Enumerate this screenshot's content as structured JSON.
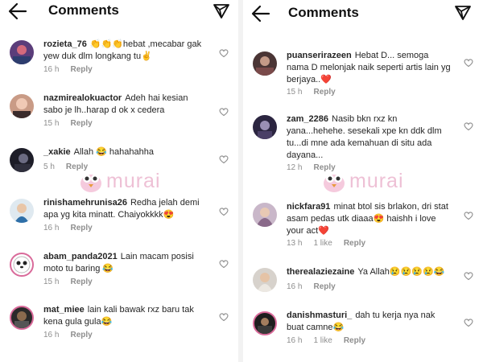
{
  "left": {
    "title": "Comments",
    "comments": [
      {
        "user": "rozieta_76",
        "text": "👏👏👏hebat ,mecabar gak yew duk dlm longkang tu✌️",
        "time": "16 h",
        "reply": "Reply"
      },
      {
        "user": "nazmirealokuactor",
        "text": "Adeh hai kesian sabo je lh..harap d ok x cedera",
        "time": "15 h",
        "reply": "Reply"
      },
      {
        "user": "_xakie",
        "text": "Allah 😂 hahahahha",
        "time": "5 h",
        "reply": "Reply"
      },
      {
        "user": "rinishamehrunisa26",
        "text": "Redha jelah demi apa yg kita minatt. Chaiyokkkk😍",
        "time": "16 h",
        "reply": "Reply"
      },
      {
        "user": "abam_panda2021",
        "text": "Lain macam posisi moto tu baring 😂",
        "time": "15 h",
        "reply": "Reply"
      },
      {
        "user": "mat_miee",
        "text": "lain kali bawak rxz baru tak kena gula gula😂",
        "time": "16 h",
        "reply": "Reply"
      }
    ]
  },
  "right": {
    "title": "Comments",
    "comments": [
      {
        "user": "puanserirazeen",
        "text": "Hebat D... semoga nama D melonjak naik seperti artis lain yg berjaya..❤️",
        "time": "15 h",
        "likes": "",
        "reply": "Reply"
      },
      {
        "user": "zam_2286",
        "text": "Nasib bkn rxz kn yana...hehehe. sesekali xpe kn ddk dlm tu...di mne ada kemahuan di situ ada dayana...",
        "time": "12 h",
        "likes": "",
        "reply": "Reply"
      },
      {
        "user": "nickfara91",
        "text": "minat btol sis brlakon, dri stat asam pedas utk diaaa😍 haishh i love your act❤️",
        "time": "13 h",
        "likes": "1 like",
        "reply": "Reply"
      },
      {
        "user": "therealaziezaine",
        "text": "Ya Allah😢😢😢😢😂",
        "time": "16 h",
        "likes": "",
        "reply": "Reply"
      },
      {
        "user": "danishmasturi_",
        "text": "dah tu kerja nya nak buat camne😂",
        "time": "16 h",
        "likes": "1 like",
        "reply": "Reply"
      }
    ]
  },
  "watermark": "murai",
  "colors": {
    "text": "#262626",
    "meta": "#8e8e8e",
    "watermark": "#e7a6c4"
  },
  "icons": [
    "back-arrow-icon",
    "send-icon",
    "heart-outline-icon",
    "murai-bird-icon"
  ]
}
